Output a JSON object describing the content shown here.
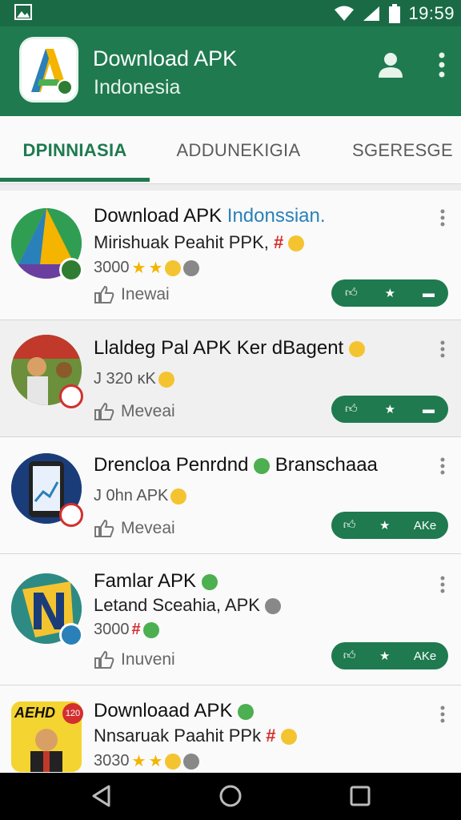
{
  "status_bar": {
    "time": "19:59",
    "icons": [
      "image-icon",
      "wifi-icon",
      "signal-icon",
      "battery-icon"
    ]
  },
  "app_bar": {
    "title": "Download APK",
    "subtitle": "Indonesia",
    "icons": [
      "account-icon",
      "more-vert-icon"
    ]
  },
  "tabs": [
    {
      "label": "DPINNIASIA",
      "active": true
    },
    {
      "label": "ADDUNEKIGIA",
      "active": false
    },
    {
      "label": "SGERESGE",
      "active": false
    }
  ],
  "items": [
    {
      "title": "Download APK",
      "title_accent": "Indonssian.",
      "subtitle": "Mirishuak Peahit PPK,",
      "meta": "3000",
      "like_label": "Inewai",
      "actions": [
        "thumb-up-icon",
        "star-icon",
        "comment-icon"
      ]
    },
    {
      "title": "Llaldeg Pal APK Ker dBagent",
      "meta": "J 320 κK",
      "like_label": "Meveai",
      "actions": [
        "thumb-up-icon",
        "star-icon",
        "comment-icon"
      ]
    },
    {
      "title": "Drencloa Penrdnd",
      "title_tail": "Branschaaa",
      "meta": "J 0hn APK",
      "like_label": "Meveai",
      "actions": [
        "thumb-up-icon",
        "star-icon",
        "AKe"
      ]
    },
    {
      "title": "Famlar APK",
      "subtitle": "Letand Sceahia, APK",
      "meta": "3000",
      "like_label": "Inuveni",
      "actions": [
        "thumb-up-icon",
        "star-icon",
        "AKe"
      ]
    },
    {
      "title": "Downloaad APK",
      "subtitle": "Nnsaruak Paahit PPk",
      "meta": "3030",
      "icon_text": "AEHD",
      "icon_badge": "120"
    }
  ],
  "colors": {
    "primary": "#1f7a4f",
    "status_bar": "#1a6b45",
    "accent_blue": "#2a80b9"
  },
  "nav_bar": {
    "icons": [
      "back-icon",
      "home-icon",
      "recents-icon"
    ]
  }
}
